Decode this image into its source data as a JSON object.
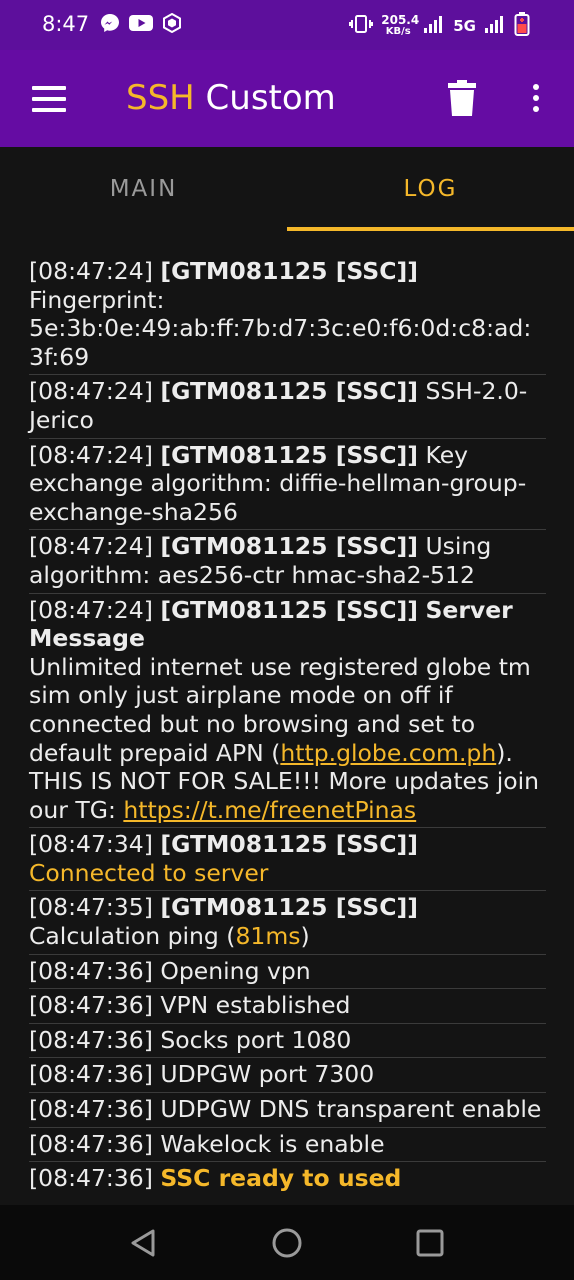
{
  "status_bar": {
    "time": "8:47",
    "net_speed_value": "205.4",
    "net_speed_unit": "KB/s",
    "network_label": "5G",
    "left_icons": [
      "messenger-icon",
      "youtube-icon",
      "vpn-app-icon"
    ],
    "right_icons": [
      "vibrate-icon",
      "signal-icon",
      "signal-icon",
      "battery-icon"
    ]
  },
  "app_bar": {
    "title_accent": "SSH",
    "title_rest": " Custom",
    "icons": [
      "menu-icon",
      "trash-icon",
      "more-vert-icon"
    ]
  },
  "tabs": [
    {
      "label": "MAIN",
      "active": false
    },
    {
      "label": "LOG",
      "active": true
    }
  ],
  "colors": {
    "status_bar": "#5d0f9c",
    "app_bar": "#650ca3",
    "accent": "#f5b82a",
    "background": "#141414"
  },
  "log": {
    "e1": {
      "time": "[08:47:24]",
      "tag": "[GTM081125 [SSC]]",
      "text": "Fingerprint: 5e:3b:0e:49:ab:ff:7b:d7:3c:e0:f6:0d:c8:ad:3f:69"
    },
    "e2": {
      "time": "[08:47:24]",
      "tag": "[GTM081125 [SSC]]",
      "text": "SSH-2.0-Jerico"
    },
    "e3": {
      "time": "[08:47:24]",
      "tag": "[GTM081125 [SSC]]",
      "text": "Key exchange algorithm: diffie-hellman-group-exchange-sha256"
    },
    "e4": {
      "time": "[08:47:24]",
      "tag": "[GTM081125 [SSC]]",
      "text": "Using algorithm: aes256-ctr hmac-sha2-512"
    },
    "e5": {
      "time": "[08:47:24]",
      "tag": "[GTM081125 [SSC]]",
      "title": "Server Message",
      "text1": "Unlimited internet use registered globe tm sim only just airplane mode on off if connected but no browsing and set to default prepaid APN (",
      "link1": "http.globe.com.ph",
      "text2": "). THIS IS NOT FOR SALE!!! More updates join our TG: ",
      "link2": "https://t.me/freenetPinas"
    },
    "e6": {
      "time": "[08:47:34]",
      "tag": "[GTM081125 [SSC]]",
      "status": "Connected to server"
    },
    "e7": {
      "time": "[08:47:35]",
      "tag": "[GTM081125 [SSC]]",
      "text": "Calculation ping (",
      "ping": "81ms",
      "close": ")"
    },
    "e8": {
      "time": "[08:47:36]",
      "text": "Opening vpn"
    },
    "e9": {
      "time": "[08:47:36]",
      "text": "VPN established"
    },
    "e10": {
      "time": "[08:47:36]",
      "text": "Socks port 1080"
    },
    "e11": {
      "time": "[08:47:36]",
      "text": "UDPGW port 7300"
    },
    "e12": {
      "time": "[08:47:36]",
      "text": "UDPGW DNS transparent enable"
    },
    "e13": {
      "time": "[08:47:36]",
      "text": "Wakelock is enable"
    },
    "e14": {
      "time": "[08:47:36]",
      "status": "SSC ready to used"
    }
  },
  "nav_bar": {
    "buttons": [
      "back-icon",
      "home-icon",
      "recents-icon"
    ]
  }
}
